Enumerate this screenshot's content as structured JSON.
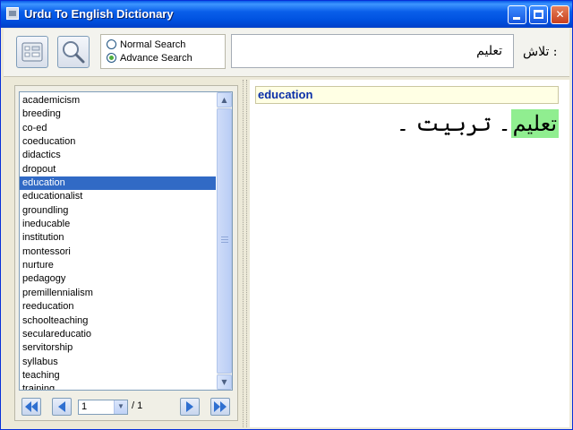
{
  "window": {
    "title": "Urdu To English Dictionary"
  },
  "toolbar": {
    "keyboard_icon": "keyboard-icon",
    "search_icon": "magnifier-icon",
    "search_modes": [
      {
        "label": "Normal Search",
        "checked": false
      },
      {
        "label": "Advance Search",
        "checked": true
      }
    ],
    "search_value": "تعلیم",
    "search_label": "تلاش :"
  },
  "word_list": {
    "items": [
      "academicism",
      "breeding",
      "co-ed",
      "coeducation",
      "didactics",
      "dropout",
      "education",
      "educationalist",
      "groundling",
      "ineducable",
      "institution",
      "montessori",
      "nurture",
      "pedagogy",
      "premillennialism",
      "reeducation",
      "schoolteaching",
      "seculareducatio",
      "servitorship",
      "syllabus",
      "teaching",
      "training"
    ],
    "selected": "education"
  },
  "pager": {
    "current_page": "1",
    "total": "/ 1"
  },
  "result": {
    "word": "education",
    "meaning_highlight": "تعلیم",
    "meaning_rest": "۔ تربیت ۔"
  },
  "colors": {
    "title_bar": "#0a5fea",
    "selection": "#316ac5",
    "highlight": "#90ee90",
    "result_word": "#0a2fa8",
    "header_bg": "#ffffe4"
  }
}
